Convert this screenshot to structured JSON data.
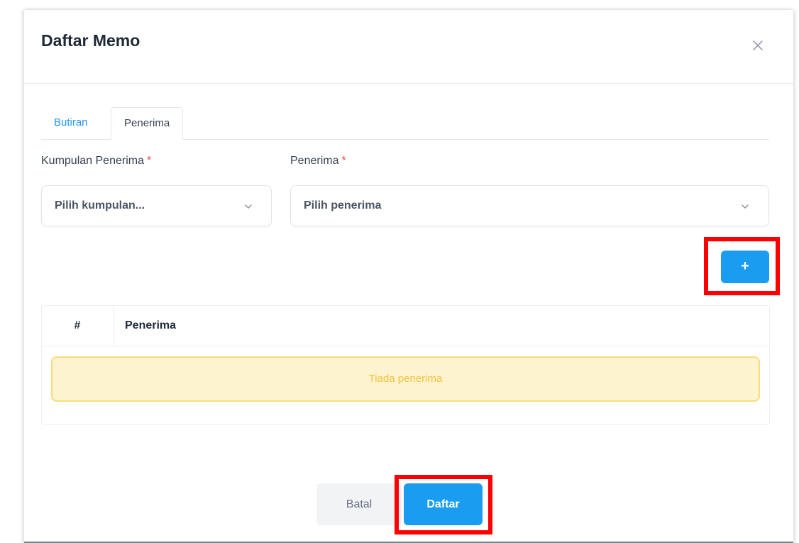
{
  "modal": {
    "title": "Daftar Memo",
    "close_icon": "close-icon"
  },
  "tabs": [
    {
      "label": "Butiran",
      "active": false
    },
    {
      "label": "Penerima",
      "active": true
    }
  ],
  "form": {
    "group_label": "Kumpulan Penerima",
    "group_required_mark": "*",
    "group_value": "Pilih kumpulan...",
    "recipient_label": "Penerima",
    "recipient_required_mark": "*",
    "recipient_value": "Pilih penerima",
    "dropdown_icon": "chevron-down-icon"
  },
  "add_button": {
    "label": "+"
  },
  "table": {
    "columns": [
      "#",
      "Penerima"
    ],
    "empty_message": "Tiada penerima"
  },
  "footer": {
    "cancel_label": "Batal",
    "submit_label": "Daftar"
  },
  "colors": {
    "primary": "#1a9df0",
    "highlight": "#ff0000",
    "required": "#ef4444",
    "warning_bg": "#fdf3cf",
    "warning_border": "#f7dc7c",
    "warning_text": "#f2c23d"
  }
}
